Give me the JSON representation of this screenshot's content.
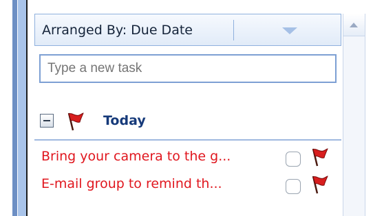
{
  "arrange": {
    "label": "Arranged By: Due Date",
    "dropdown_icon": "triangle-down-icon"
  },
  "new_task": {
    "placeholder": "Type a new task",
    "value": ""
  },
  "group": {
    "title": "Today",
    "collapse_icon": "collapse-minus-icon",
    "flag_icon": "red-flag-icon"
  },
  "tasks": [
    {
      "subject": "Bring your camera to the g...",
      "flag_icon": "red-flag-icon"
    },
    {
      "subject": "E-mail group to remind th...",
      "flag_icon": "red-flag-icon"
    }
  ],
  "colors": {
    "task_text": "#e0161e",
    "group_title": "#163a7a",
    "accent_border": "#8eb0dd"
  }
}
